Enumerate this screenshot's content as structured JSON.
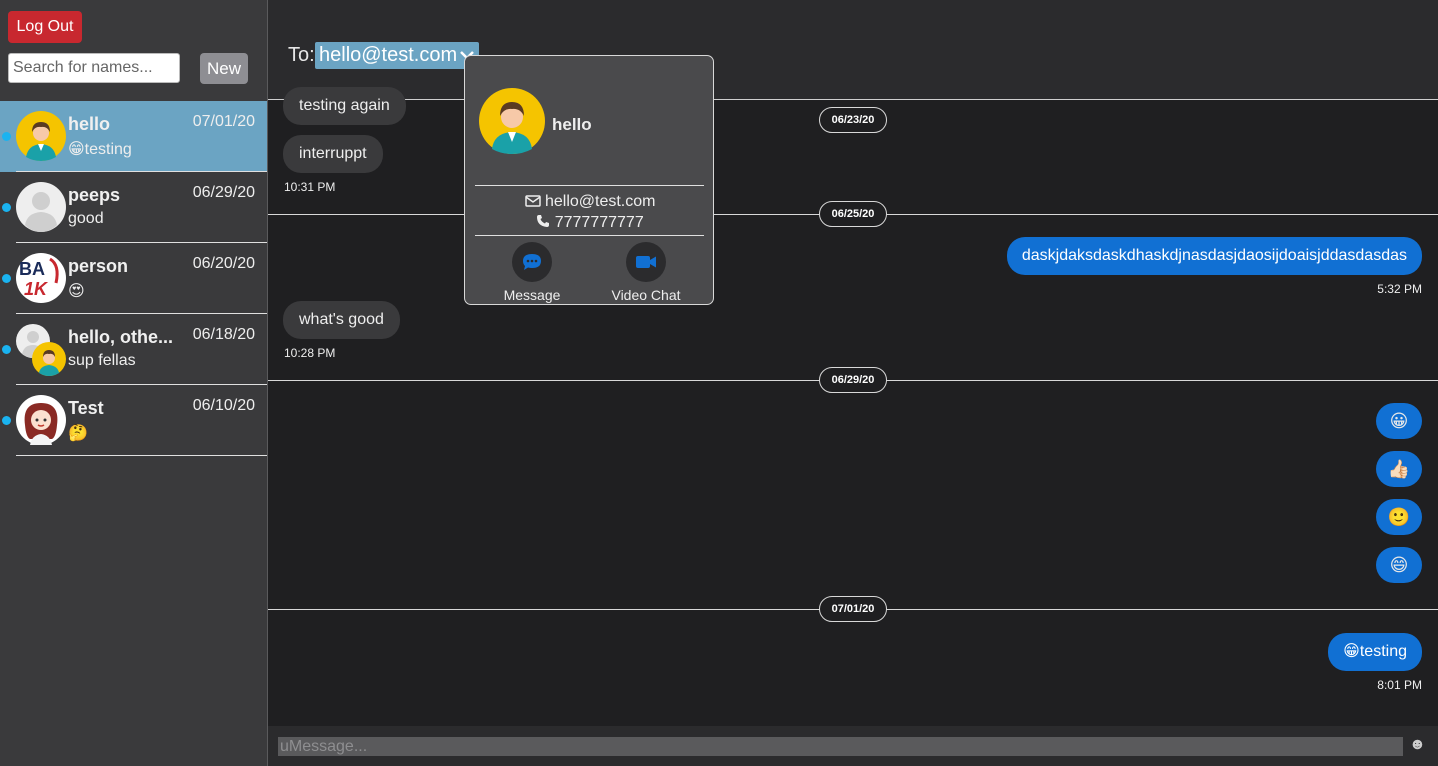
{
  "sidebar": {
    "logout_label": "Log Out",
    "search_placeholder": "Search for names...",
    "new_label": "New",
    "conversations": [
      {
        "name": "hello",
        "date": "07/01/20",
        "preview": "😁testing",
        "unread": true,
        "active": true
      },
      {
        "name": "peeps",
        "date": "06/29/20",
        "preview": "good",
        "unread": true,
        "active": false
      },
      {
        "name": "person",
        "date": "06/20/20",
        "preview": "😍",
        "unread": true,
        "active": false
      },
      {
        "name": "hello, othe...",
        "date": "06/18/20",
        "preview": "sup fellas",
        "unread": true,
        "active": false
      },
      {
        "name": "Test",
        "date": "06/10/20",
        "preview": "🤔",
        "unread": true,
        "active": false
      }
    ]
  },
  "header": {
    "to_label": "To:",
    "recipient": "hello@test.com"
  },
  "thread": {
    "messages": [
      {
        "text": "testing again"
      },
      {
        "text": "interruppt",
        "time": "10:31 PM"
      },
      {
        "text": "daskjdaksdaskdhaskdjnasdasjdaosijdoaisjddasdasdas",
        "time": "5:32 PM"
      },
      {
        "text": "what's good",
        "time": "10:28 PM"
      },
      {
        "text": "😀"
      },
      {
        "text": "👍🏻"
      },
      {
        "text": "🙂"
      },
      {
        "text": "😄"
      },
      {
        "text": "😁testing",
        "time": "8:01 PM"
      }
    ],
    "dates": [
      "06/23/20",
      "06/25/20",
      "06/29/20",
      "07/01/20"
    ]
  },
  "composer": {
    "placeholder": "uMessage...",
    "emoji_button": "☻"
  },
  "contact_card": {
    "name": "hello",
    "email": "hello@test.com",
    "phone": "7777777777",
    "actions": [
      "Message",
      "Video Chat"
    ]
  },
  "colors": {
    "sidebar_bg": "#3a3a3c",
    "active_conversation": "#6ba4c3",
    "unread_dot": "#1ab3f0",
    "outgoing_bubble": "#1170d3",
    "incoming_bubble": "#3a3a3c",
    "logout_red": "#c8282f"
  }
}
